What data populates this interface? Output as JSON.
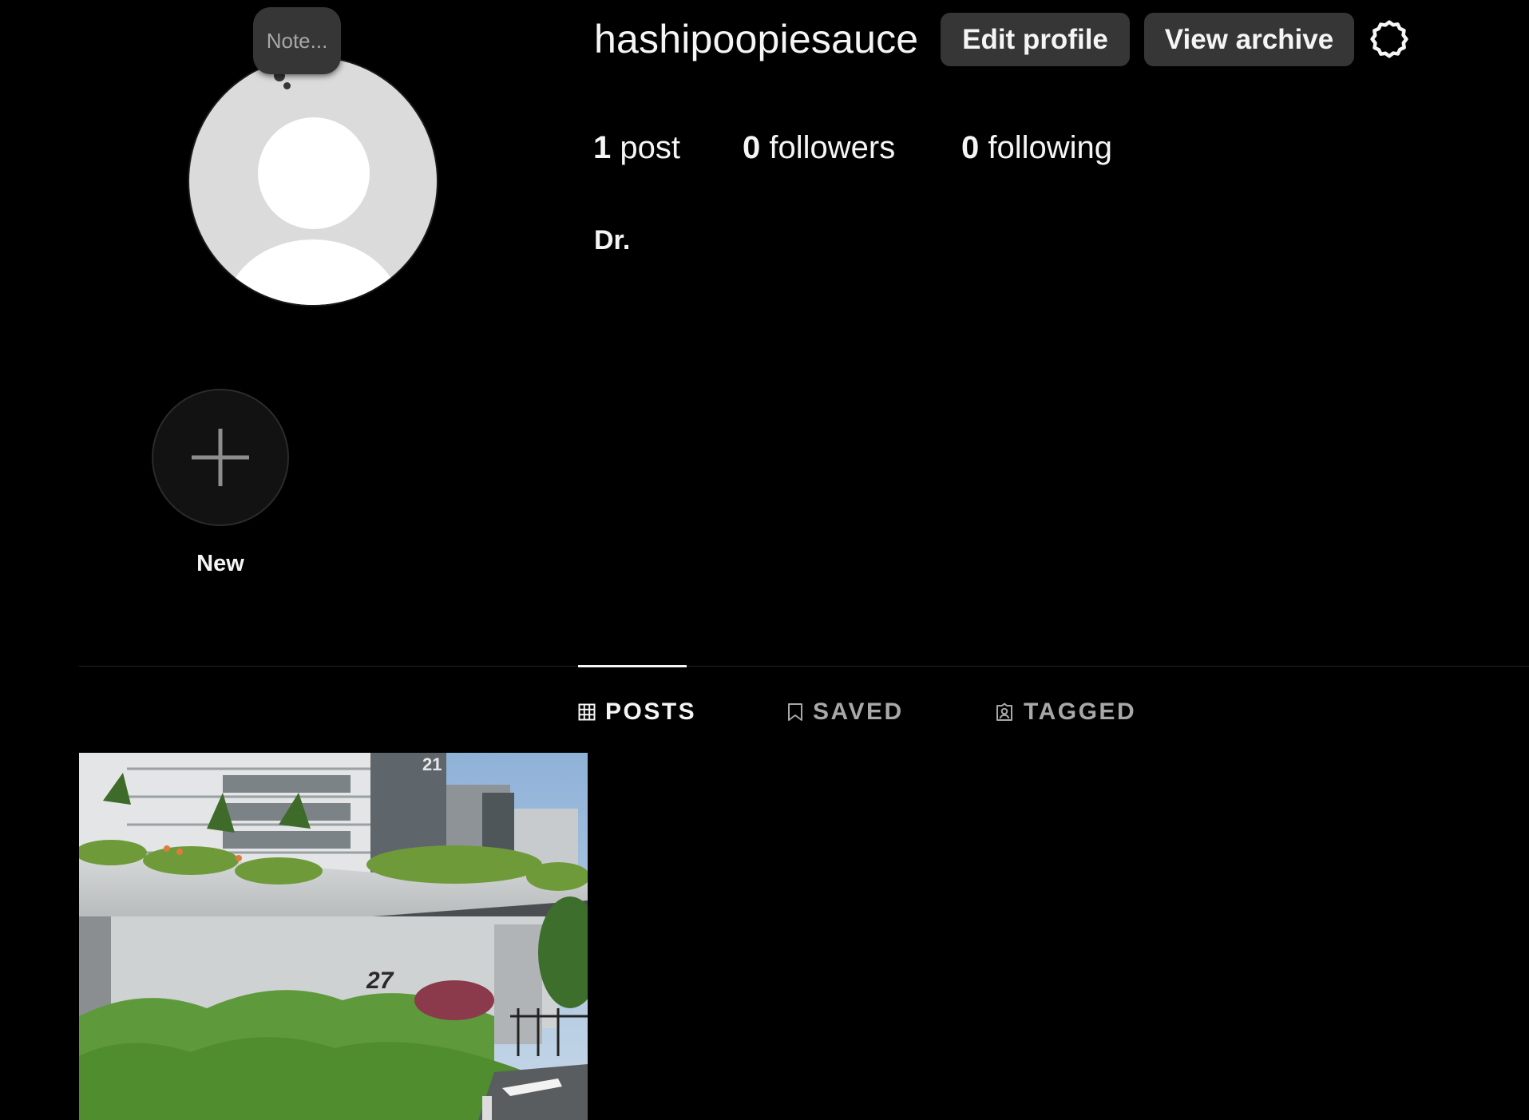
{
  "profile": {
    "username": "hashipoopiesauce",
    "note_placeholder": "Note...",
    "bio_name": "Dr.",
    "edit_profile_label": "Edit profile",
    "view_archive_label": "View archive",
    "settings_icon": "gear-icon"
  },
  "stats": {
    "posts_count": "1",
    "posts_label": "post",
    "followers_count": "0",
    "followers_label": "followers",
    "following_count": "0",
    "following_label": "following"
  },
  "highlights": {
    "new_label": "New",
    "new_icon": "plus-icon"
  },
  "tabs": [
    {
      "label": "POSTS",
      "icon": "grid-icon",
      "active": true
    },
    {
      "label": "SAVED",
      "icon": "bookmark-icon",
      "active": false
    },
    {
      "label": "TAGGED",
      "icon": "tagged-user-icon",
      "active": false
    }
  ],
  "posts": [
    {
      "description_visible": "building photo",
      "building_number": "27"
    }
  ],
  "colors": {
    "background": "#000000",
    "button_bg": "#363636",
    "text_primary": "#f5f5f5",
    "text_secondary": "#a8a8a8",
    "divider": "#262626"
  }
}
